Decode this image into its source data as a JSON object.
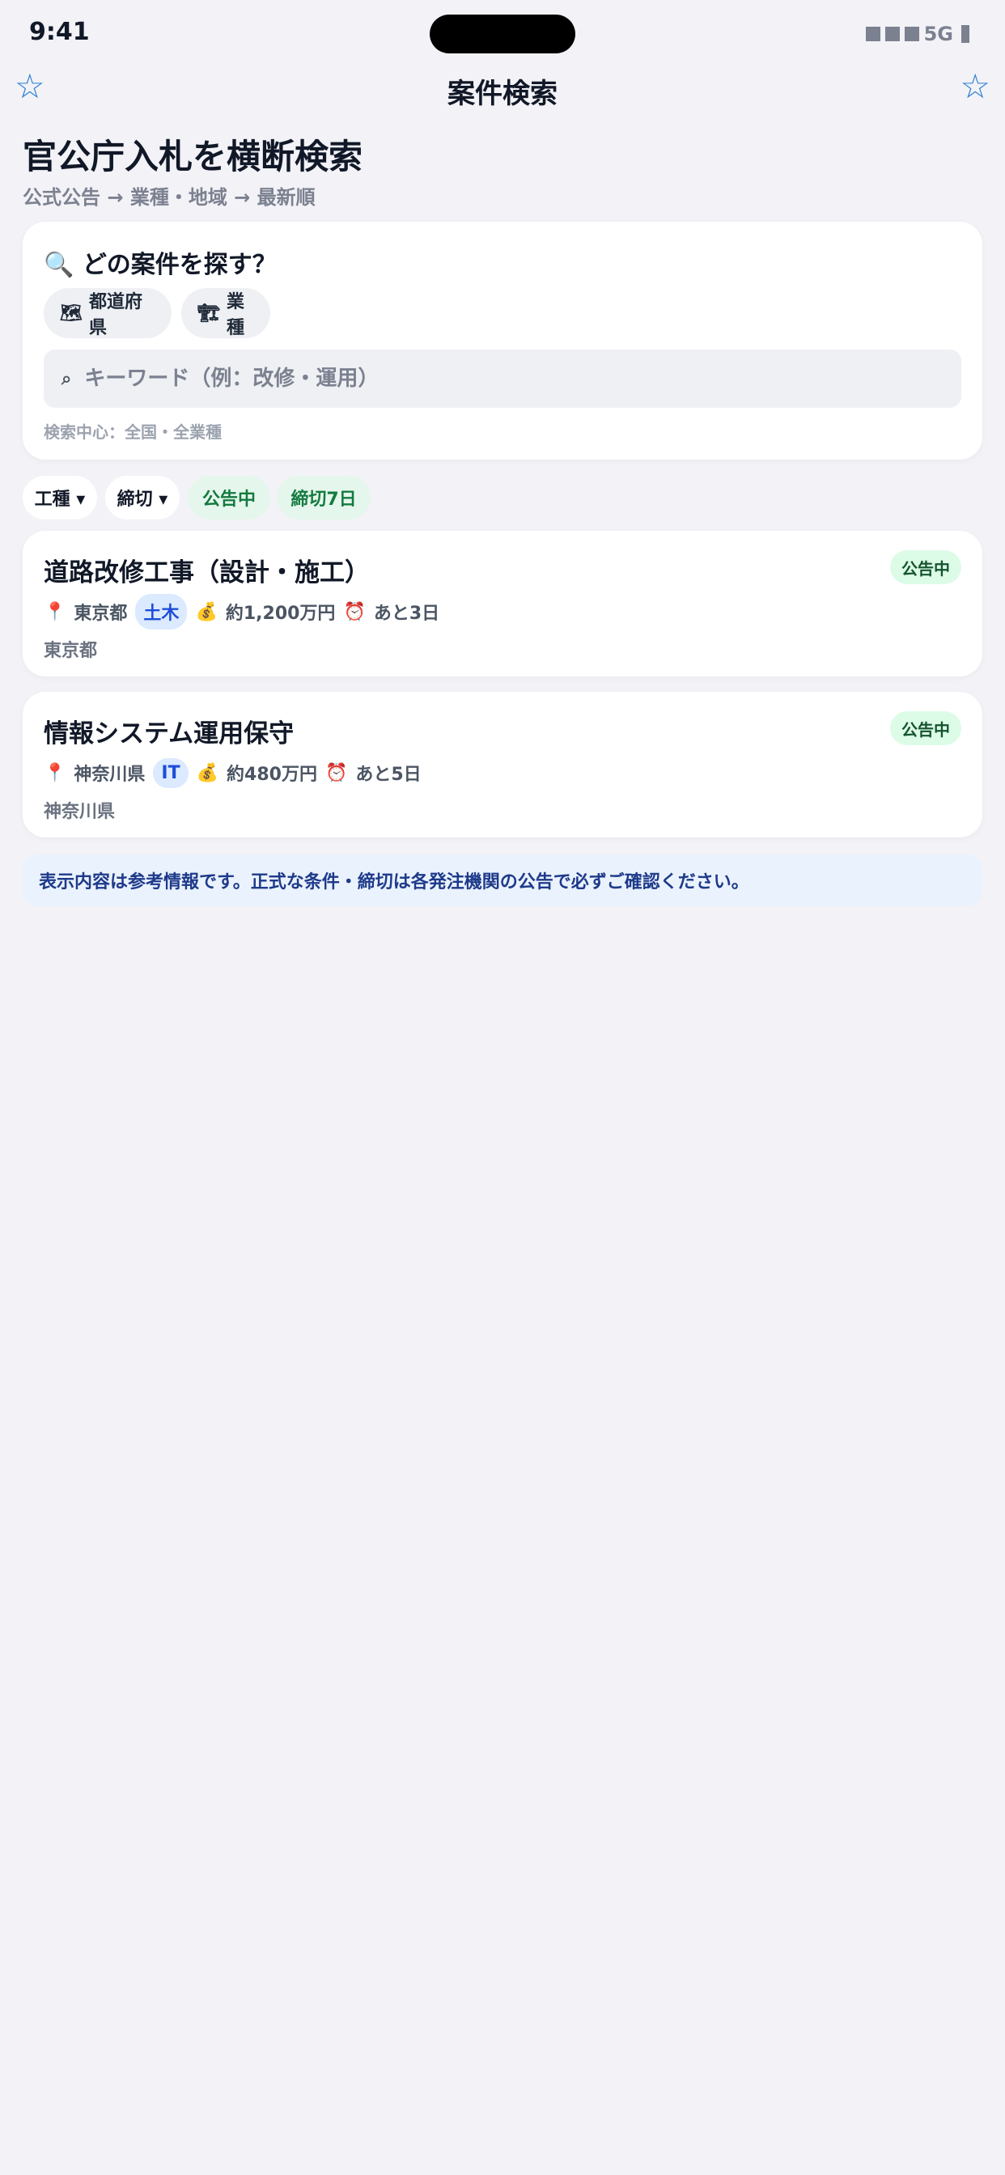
{
  "status": {
    "time": "9:41",
    "network": "5G"
  },
  "nav": {
    "title": "案件検索",
    "left_icon": "star-outline-icon",
    "right_icon": "star-outline-icon",
    "star_glyph": "☆"
  },
  "header": {
    "title": "官公庁入札を横断検索",
    "subtitle": "公式公告 → 業種・地域 → 最新順"
  },
  "search": {
    "heading": "どの案件を探す？",
    "heading_icon": "🔍",
    "chips": [
      {
        "icon": "🗺",
        "label": "都道府県"
      },
      {
        "icon": "🏗",
        "label": "業種"
      }
    ],
    "input_value": "",
    "placeholder": "キーワード（例：改修・運用）",
    "search_glyph": "⌕",
    "hint": "検索中心：全国・全業種"
  },
  "filters": [
    {
      "label": "工種 ▾",
      "style": "white"
    },
    {
      "label": "締切 ▾",
      "style": "white"
    },
    {
      "label": "公告中",
      "style": "green"
    },
    {
      "label": "締切7日",
      "style": "green"
    }
  ],
  "results": [
    {
      "title": "道路改修工事（設計・施工）",
      "status": "公告中",
      "pin": "📍",
      "prefecture": "東京都",
      "category": "土木",
      "money_icon": "💰",
      "amount": "約1,200万円",
      "clock_icon": "⏰",
      "remaining": "あと3日",
      "location": "東京都"
    },
    {
      "title": "情報システム運用保守",
      "status": "公告中",
      "pin": "📍",
      "prefecture": "神奈川県",
      "category": "IT",
      "money_icon": "💰",
      "amount": "約480万円",
      "clock_icon": "⏰",
      "remaining": "あと5日",
      "location": "神奈川県"
    }
  ],
  "notice": "表示内容は参考情報です。正式な条件・締切は各発注機関の公告で必ずご確認ください。",
  "colors": {
    "background": "#f2f2f7",
    "accent": "#2b7fd4",
    "green_badge": "#dcfce7",
    "tag_blue": "#dbeafe",
    "notice_bg": "#eaf2fd"
  }
}
